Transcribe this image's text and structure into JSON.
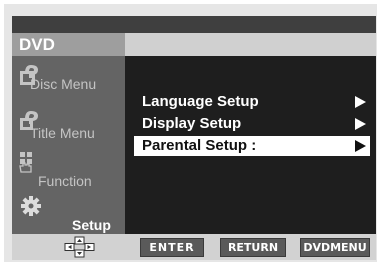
{
  "header": {
    "title": "DVD"
  },
  "sidebar": {
    "items": [
      {
        "label": "Disc Menu",
        "icon": "disc-icon"
      },
      {
        "label": "Title Menu",
        "icon": "title-icon"
      },
      {
        "label": "Function",
        "icon": "hand-icon"
      },
      {
        "label": "Setup",
        "icon": "gear-icon",
        "active": true
      }
    ]
  },
  "menu": {
    "items": [
      {
        "label": "Language Setup"
      },
      {
        "label": "Display Setup"
      },
      {
        "label": "Parental Setup :",
        "selected": true
      }
    ]
  },
  "footer": {
    "navigation_icon": "dpad-icon",
    "enter_label": "ENTER",
    "return_label": "RETURN",
    "dvdmenu_label": "DVDMENU"
  },
  "colors": {
    "sidebar_bg": "#646464",
    "main_bg": "#1e1e1e",
    "selection": "#ffffff",
    "topbar": "#d0d0d0",
    "button_bg": "#5a5a5a"
  }
}
